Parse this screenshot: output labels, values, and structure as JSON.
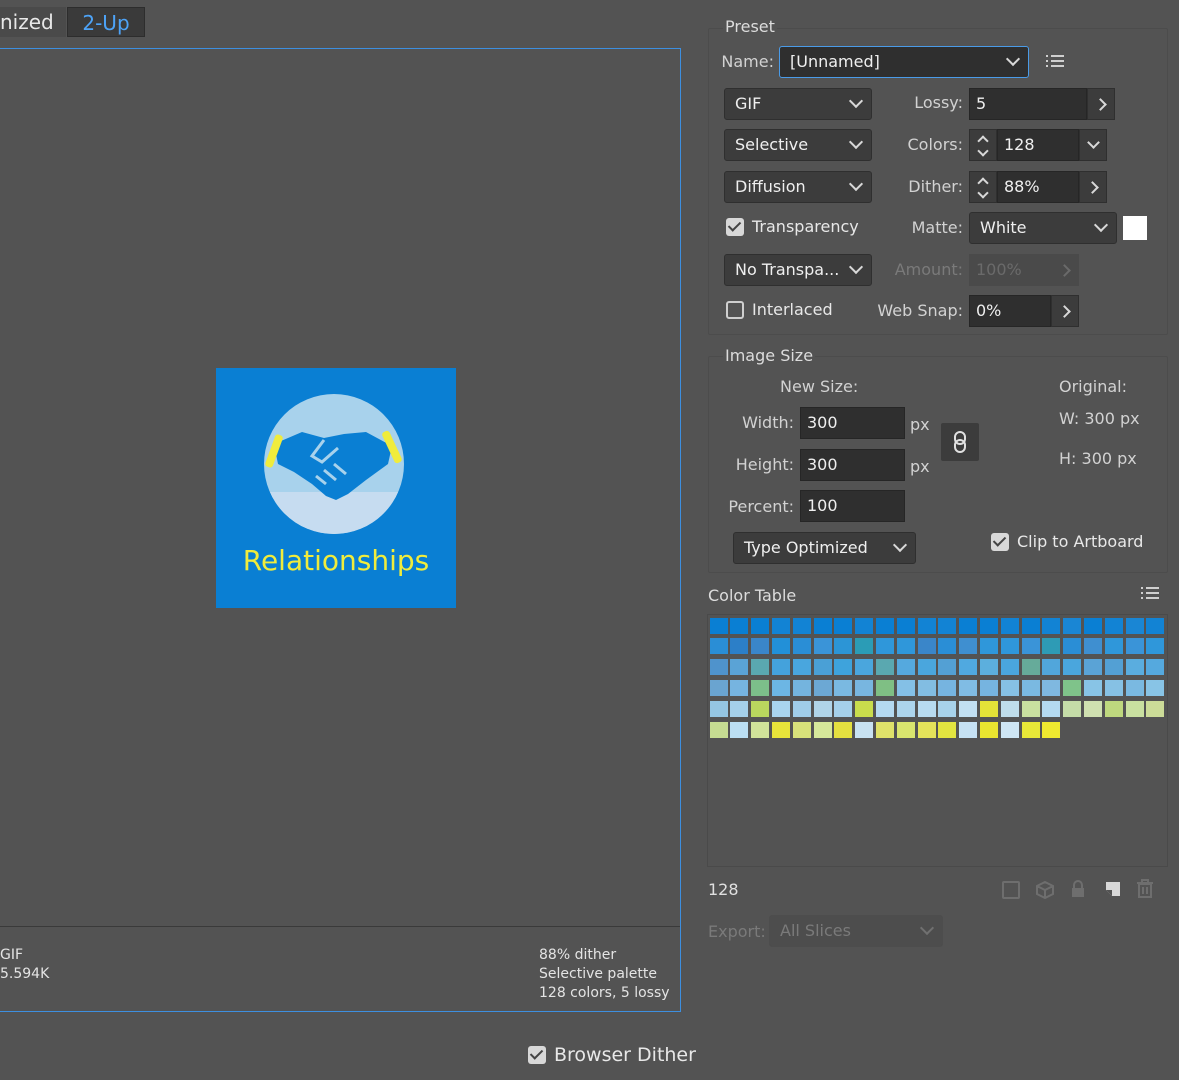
{
  "tabs": {
    "optimized": "nized",
    "two_up": "2-Up"
  },
  "preview": {
    "logo_title": "Relationships",
    "info_left": [
      "GIF",
      "5.594K"
    ],
    "info_right": [
      "88% dither",
      "Selective palette",
      "128 colors, 5 lossy"
    ]
  },
  "browser_dither": {
    "label": "Browser Dither",
    "checked": true
  },
  "preset": {
    "legend": "Preset",
    "name_label": "Name:",
    "name_value": "[Unnamed]",
    "format": "GIF",
    "reduction": "Selective",
    "dither_algo": "Diffusion",
    "transparency_label": "Transparency",
    "transparency_checked": true,
    "trans_dither": "No Transpa...",
    "interlaced_label": "Interlaced",
    "interlaced_checked": false,
    "lossy_label": "Lossy:",
    "lossy_value": "5",
    "colors_label": "Colors:",
    "colors_value": "128",
    "dither_label": "Dither:",
    "dither_value": "88%",
    "matte_label": "Matte:",
    "matte_value": "White",
    "amount_label": "Amount:",
    "amount_value": "100%",
    "websnap_label": "Web Snap:",
    "websnap_value": "0%"
  },
  "image_size": {
    "legend": "Image Size",
    "new_size_label": "New Size:",
    "original_label": "Original:",
    "width_label": "Width:",
    "width_value": "300",
    "height_label": "Height:",
    "height_value": "300",
    "percent_label": "Percent:",
    "percent_value": "100",
    "unit": "px",
    "orig_w": "W:  300 px",
    "orig_h": "H:  300 px",
    "quality": "Type Optimized",
    "clip_label": "Clip to Artboard",
    "clip_checked": true
  },
  "color_table": {
    "legend": "Color Table",
    "count": "128",
    "colors": [
      "#0a7fd3",
      "#0a7fd3",
      "#0a7fd3",
      "#1283d4",
      "#1283d4",
      "#0a7fd3",
      "#0a7fd3",
      "#1283d4",
      "#0a7fd3",
      "#0a7fd3",
      "#1283d4",
      "#1283d4",
      "#0a7fd3",
      "#0a7fd3",
      "#1283d4",
      "#0a7fd3",
      "#1283d4",
      "#1a86d4",
      "#0a7fd3",
      "#1283d4",
      "#1a86d4",
      "#1283d4",
      "#2a8ed6",
      "#2c7fc8",
      "#3a86c9",
      "#2290d8",
      "#2a8ed6",
      "#3a94d8",
      "#2c95d6",
      "#2b9cb6",
      "#2f97da",
      "#2f97da",
      "#3a86c9",
      "#2a8ed6",
      "#3f8fd0",
      "#2f97da",
      "#2f97da",
      "#3a94d8",
      "#2e9bb5",
      "#2a8ed6",
      "#3f8fd0",
      "#2f97da",
      "#3a94d8",
      "#2f97da",
      "#4f93cc",
      "#5aa3d6",
      "#5aa8b0",
      "#44a2dc",
      "#49a6de",
      "#4aa0d6",
      "#3ea3dc",
      "#4aa6dd",
      "#5aa8b0",
      "#55a9de",
      "#4aa6dd",
      "#53a0d4",
      "#50a9e0",
      "#5cafdd",
      "#4aa6dd",
      "#66ab9a",
      "#51a6db",
      "#4aa6dd",
      "#5aa3d6",
      "#53a0d4",
      "#5aaddf",
      "#55a9de",
      "#6aa4d0",
      "#76b4e0",
      "#7cbf8a",
      "#6cb6e4",
      "#74b4de",
      "#6ca8d4",
      "#7ab9e1",
      "#78b6e0",
      "#7fbf84",
      "#84c0e6",
      "#82bde2",
      "#76b4e0",
      "#80bce4",
      "#76b4e0",
      "#86c1e4",
      "#7ab9e1",
      "#7fb8e0",
      "#7fc38a",
      "#88c4e6",
      "#86c1e4",
      "#7ab9e1",
      "#88c4e6",
      "#95c6e3",
      "#a5d0ea",
      "#b9d65e",
      "#a9d4ee",
      "#a0cde9",
      "#b0d4e8",
      "#a5d0ea",
      "#c9dc4c",
      "#b4d9f0",
      "#acd4ec",
      "#b8dbf0",
      "#a8d2ea",
      "#c2e0f2",
      "#e4e338",
      "#bfddea",
      "#c9e0a0",
      "#b4d9f0",
      "#c5dca8",
      "#cfe0b0",
      "#bed87e",
      "#c9e0a0",
      "#ccdc98",
      "#c6dc92",
      "#bcdff3",
      "#d1e29a",
      "#e8e43a",
      "#d8e27a",
      "#d6e89a",
      "#e4e040",
      "#c8e2f2",
      "#dfe26a",
      "#d9e56e",
      "#e4e35a",
      "#e2e440",
      "#c6e2f4",
      "#e9e530",
      "#cfe6f4",
      "#e8e838",
      "#f0ea30"
    ]
  },
  "export": {
    "label": "Export:",
    "value": "All Slices"
  }
}
